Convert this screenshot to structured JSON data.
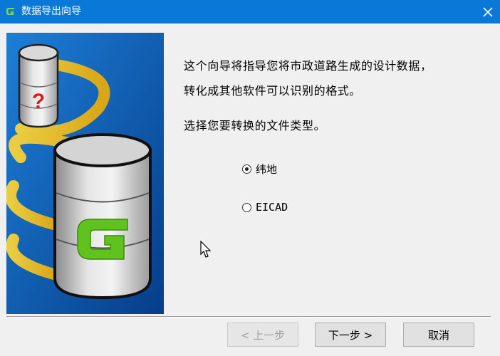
{
  "window": {
    "title": "数据导出向导",
    "logo_icon": "green-g-logo",
    "close_icon": "close-icon"
  },
  "wizard": {
    "intro_line1": "这个向导将指导您将市政道路生成的设计数据，",
    "intro_line2": "转化成其他软件可以识别的格式。",
    "prompt": "选择您要转换的文件类型。",
    "options": [
      {
        "label": "纬地",
        "checked": true
      },
      {
        "label": "EICAD",
        "checked": false
      }
    ]
  },
  "buttons": {
    "back": "< 上一步",
    "next": "下一步 >",
    "cancel": "取消"
  },
  "banner": {
    "question_mark": "?",
    "logo_letter": "G"
  },
  "colors": {
    "titlebar": "#0a78d7",
    "banner_blue": "#0b57a8",
    "ribbon_yellow": "#f5c623",
    "logo_green": "#5fc21f"
  }
}
